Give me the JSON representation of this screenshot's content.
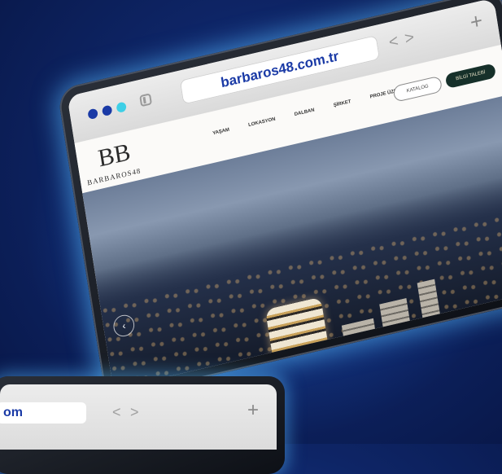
{
  "browser": {
    "url": "barbaros48.com.tr",
    "back_glyph": "<",
    "forward_glyph": ">",
    "new_tab_glyph": "+",
    "dots": [
      "#1a3aa6",
      "#1a3aa6",
      "#3ecfe6"
    ]
  },
  "site": {
    "logo_mark": "BB",
    "logo_text": "BARBAROS48",
    "menu": [
      "YAŞAM",
      "LOKASYON",
      "DALBAN",
      "ŞİRKET",
      "PROJE ÜZERİNE"
    ],
    "catalog_button": "KATALOG",
    "contact_button": "BİLGİ TALEBİ",
    "prev_glyph": "‹"
  },
  "second_device": {
    "url_partial": "om",
    "back_glyph": "<",
    "forward_glyph": ">",
    "new_tab_glyph": "+"
  }
}
